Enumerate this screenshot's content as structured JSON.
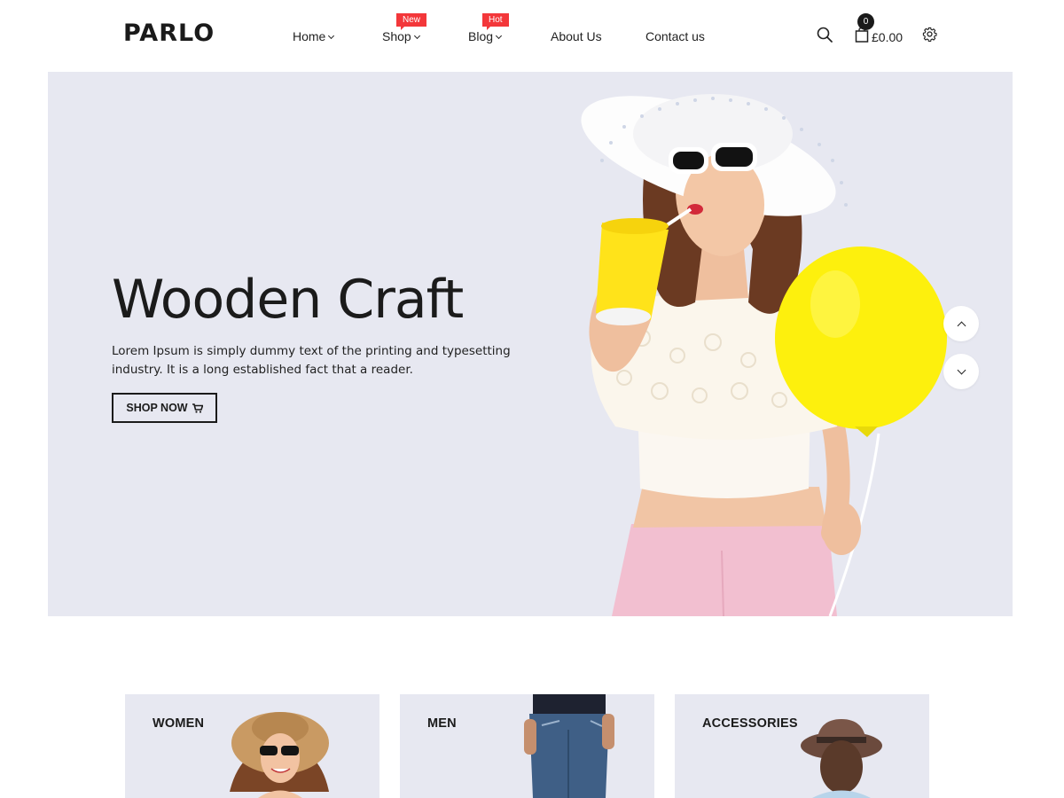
{
  "brand": {
    "logo": "PARLO"
  },
  "nav": {
    "items": [
      {
        "label": "Home",
        "has_dropdown": true,
        "badge": ""
      },
      {
        "label": "Shop",
        "has_dropdown": true,
        "badge": "New"
      },
      {
        "label": "Blog",
        "has_dropdown": true,
        "badge": "Hot"
      },
      {
        "label": "About Us",
        "has_dropdown": false,
        "badge": ""
      },
      {
        "label": "Contact us",
        "has_dropdown": false,
        "badge": ""
      }
    ],
    "badge_color": "#f3373a"
  },
  "header_actions": {
    "search_icon": "search-icon",
    "cart_icon": "shopping-bag-icon",
    "cart_count": "0",
    "cart_total": "£0.00",
    "settings_icon": "gear-icon"
  },
  "hero": {
    "title": "Wooden Craft",
    "text": "Lorem Ipsum is simply dummy text of the printing and typesetting industry. It is a long established fact that a reader.",
    "button_label": "SHOP NOW",
    "button_icon": "cart-icon",
    "background": "#e7e8f1",
    "prev_icon": "chevron-up-icon",
    "next_icon": "chevron-down-icon"
  },
  "categories": [
    {
      "label": "WOMEN"
    },
    {
      "label": "MEN"
    },
    {
      "label": "ACCESSORIES"
    }
  ],
  "colors": {
    "accent": "#1b1b1b",
    "panel": "#e7e8f1",
    "balloon": "#fdf00d"
  }
}
